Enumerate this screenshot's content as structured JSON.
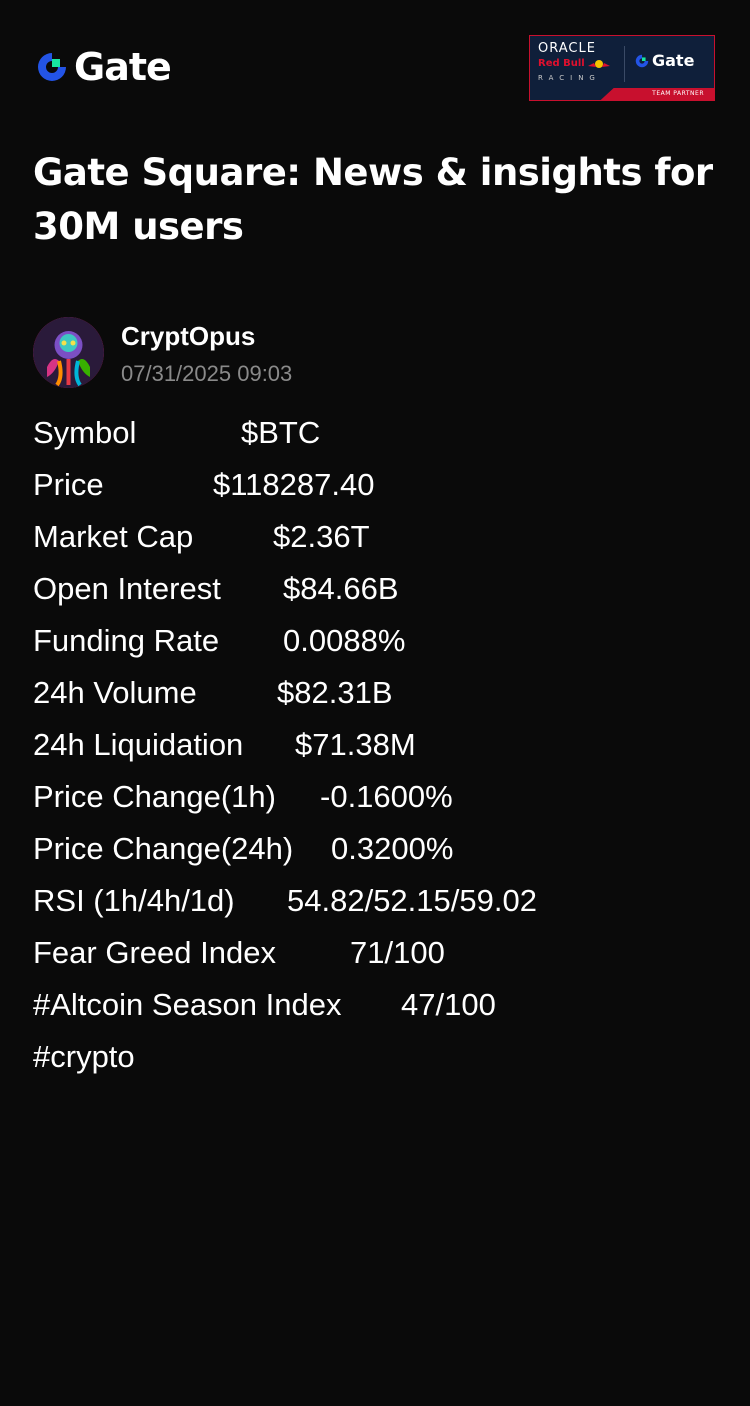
{
  "header": {
    "logo_text": "Gate",
    "partner_badge": {
      "oracle": "ORACLE",
      "redbull": "Red Bull",
      "racing": "RACING",
      "gate": "Gate",
      "team_partner": "TEAM PARTNER"
    }
  },
  "title": "Gate Square: News & insights for 30M users",
  "post": {
    "author": "CryptOpus",
    "timestamp": "07/31/2025 09:03",
    "stats": [
      {
        "label": "Symbol",
        "value": "$BTC"
      },
      {
        "label": "Price",
        "value": "$118287.40"
      },
      {
        "label": "Market Cap",
        "value": "$2.36T"
      },
      {
        "label": "Open Interest",
        "value": "$84.66B"
      },
      {
        "label": "Funding Rate",
        "value": "0.0088%"
      },
      {
        "label": "24h Volume",
        "value": "$82.31B"
      },
      {
        "label": "24h Liquidation",
        "value": "$71.38M"
      },
      {
        "label": "Price Change(1h)",
        "value": "-0.1600%"
      },
      {
        "label": "Price Change(24h)",
        "value": "0.3200%"
      },
      {
        "label": "RSI (1h/4h/1d)",
        "value": "54.82/52.15/59.02"
      },
      {
        "label": "Fear Greed Index",
        "value": "71/100"
      },
      {
        "label": "#Altcoin Season Index",
        "value": "47/100"
      }
    ],
    "hashtag": "#crypto"
  },
  "colors": {
    "background": "#0a0a0a",
    "brand_blue": "#2354e6",
    "brand_green": "#17e6a1",
    "muted_text": "#8a8a8a",
    "partner_red": "#c8102e",
    "partner_navy": "#0f1f3a"
  },
  "icons": {
    "logo": "gate-logo-icon",
    "bull": "red-bull-icon"
  }
}
